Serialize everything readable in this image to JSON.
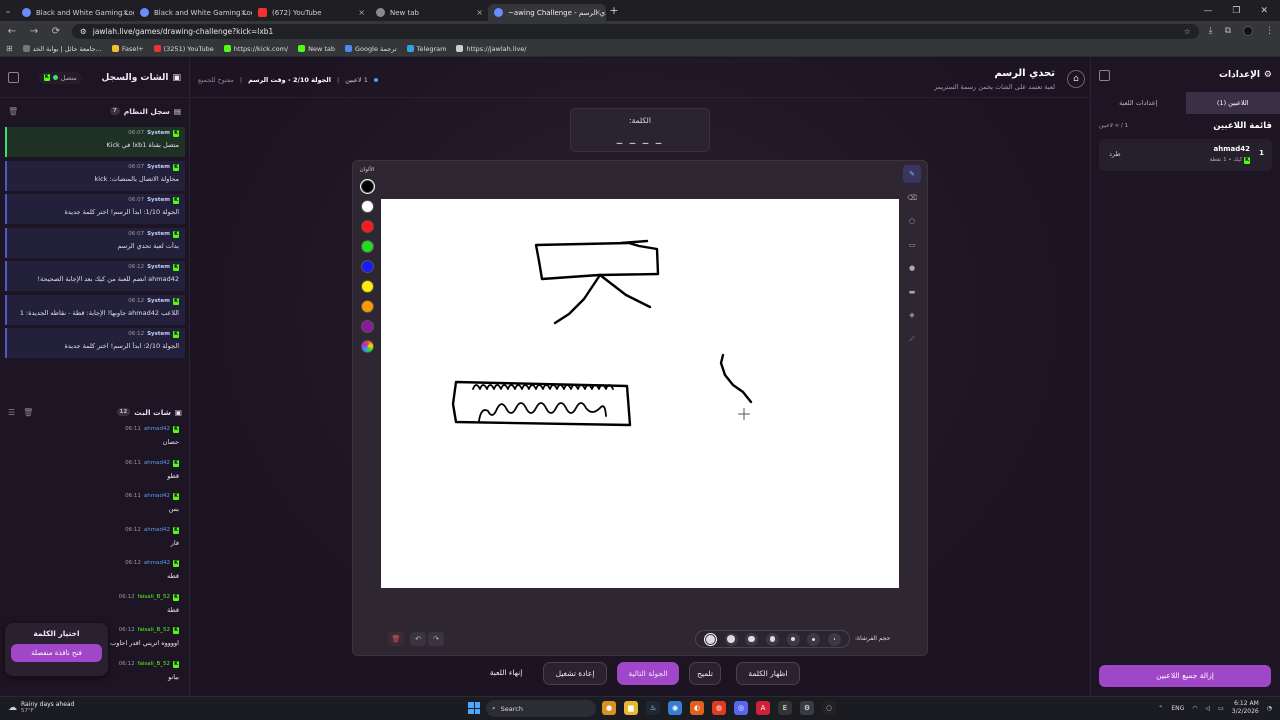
{
  "browser": {
    "tabs": [
      {
        "title": "Black and White Gaming Logo",
        "icon": "globe-icon",
        "active": false
      },
      {
        "title": "Black and White Gaming Logo",
        "icon": "globe-icon",
        "active": false
      },
      {
        "title": "(672) YouTube",
        "icon": "youtube-icon",
        "active": false
      },
      {
        "title": "New tab",
        "icon": "newtab-icon",
        "active": false
      },
      {
        "title": "~awing Challenge - تحدي الرسم",
        "icon": "jawlah-icon",
        "active": true
      }
    ],
    "tab_close": "×",
    "new_tab": "+",
    "url": "jawlah.live/games/drawing-challenge?kick=lxb1",
    "bookmarks": [
      {
        "label": "جامعة حائل | بوابة الخد...",
        "color": "#777"
      },
      {
        "label": "Fasel+",
        "color": "#f0c030"
      },
      {
        "label": "(3251) YouTube",
        "color": "#e33"
      },
      {
        "label": "https://kick.com/",
        "color": "#53fc18"
      },
      {
        "label": "New tab",
        "color": "#53fc18"
      },
      {
        "label": "Google ترجمة",
        "color": "#4a8cf0"
      },
      {
        "label": "Telegram",
        "color": "#2ca5e0"
      },
      {
        "label": "https://jawlah.live/",
        "color": "#ccc"
      }
    ]
  },
  "chat_panel": {
    "title": "الشات والسجل",
    "status": "متصل",
    "system_log": {
      "title": "سجل النظام",
      "count": "7",
      "messages": [
        {
          "user": "System",
          "time": "06:07",
          "text": "متصل بقناة lxb1 في Kick"
        },
        {
          "user": "System",
          "time": "06:07",
          "text": "محاولة الاتصال بالمنصات: kick"
        },
        {
          "user": "System",
          "time": "06:07",
          "text": "الجولة 1/10: ابدأ الرسم! اختر كلمة جديدة"
        },
        {
          "user": "System",
          "time": "06:07",
          "text": "بدأت لعبة تحدي الرسم"
        },
        {
          "user": "System",
          "time": "06:12",
          "text": "ahmad42 انضم للعبة من كيك بعد الإجابة الصحيحة!"
        },
        {
          "user": "System",
          "time": "06:12",
          "text": "اللاعب ahmad42 جاوبها! الإجابة: قطة - نقاطه الجديدة: 1"
        },
        {
          "user": "System",
          "time": "06:12",
          "text": "الجولة 2/10: ابدأ الرسم! اختر كلمة جديدة"
        }
      ]
    },
    "live_chat": {
      "title": "شات البث",
      "count": "12",
      "messages": [
        {
          "user": "ahmad42",
          "time": "06:11",
          "text": "حصان",
          "green": false
        },
        {
          "user": "ahmad42",
          "time": "06:11",
          "text": "قطو",
          "green": false
        },
        {
          "user": "ahmad42",
          "time": "06:11",
          "text": "بس",
          "green": false
        },
        {
          "user": "ahmad42",
          "time": "06:12",
          "text": "فار",
          "green": false
        },
        {
          "user": "ahmad42",
          "time": "06:12",
          "text": "قطه",
          "green": false
        },
        {
          "user": "faisali_B_52",
          "time": "06:12",
          "text": "قطة",
          "green": true
        },
        {
          "user": "faisali_B_52",
          "time": "06:12",
          "text": "اووووه اتريني اقدر احاوب",
          "green": true
        },
        {
          "user": "faisali_B_52",
          "time": "06:12",
          "text": "بيانو",
          "green": true
        }
      ]
    },
    "pick_word": {
      "title": "اختيار الكلمة",
      "button": "فتح نافذة منفصلة"
    }
  },
  "game": {
    "title": "تحدي الرسم",
    "subtitle": "لعبة تعتمد على الشات يخمن رسمة الستريمر",
    "players_count": "1 لاعبين",
    "round": "الجولة 2/10 - وقت الرسم",
    "open_to_all": "مفتوح للجميع",
    "word_label": "الكلمة:",
    "word_mask": "_ _ _ _",
    "colors_label": "الألوان",
    "colors": [
      "#000000",
      "#ffffff",
      "#ff1a1a",
      "#22dd22",
      "#1a1aff",
      "#ffee00",
      "#ff9900",
      "#8a1a9a"
    ],
    "brush_size_label": "حجم الفرشاة:",
    "brush_sizes": [
      1,
      2,
      3,
      4,
      5,
      6,
      8
    ],
    "selected_brush": 1,
    "actions": {
      "show_word": "اظهار الكلمة",
      "hint": "تلميح",
      "next_round": "الجولة التالية",
      "restart": "إعادة تشغيل",
      "end_game": "إنهاء اللعبة"
    }
  },
  "settings_panel": {
    "title": "الإعدادات",
    "tabs": [
      "اللاعبين (1)",
      "إعدادات اللعبة"
    ],
    "players_title": "قائمة اللاعبين",
    "players_count": "1 / ∞ لاعبين",
    "players": [
      {
        "rank": "1",
        "name": "ahmad42",
        "meta": "كيك • 1 نقطة",
        "kick_label": "طرد"
      }
    ],
    "clear_all": "إزالة جميع اللاعبين"
  },
  "taskbar": {
    "weather_title": "Rainy days ahead",
    "weather_temp": "57°F",
    "search_placeholder": "Search",
    "lang": "ENG",
    "time": "6:12 AM",
    "date": "3/2/2026"
  }
}
